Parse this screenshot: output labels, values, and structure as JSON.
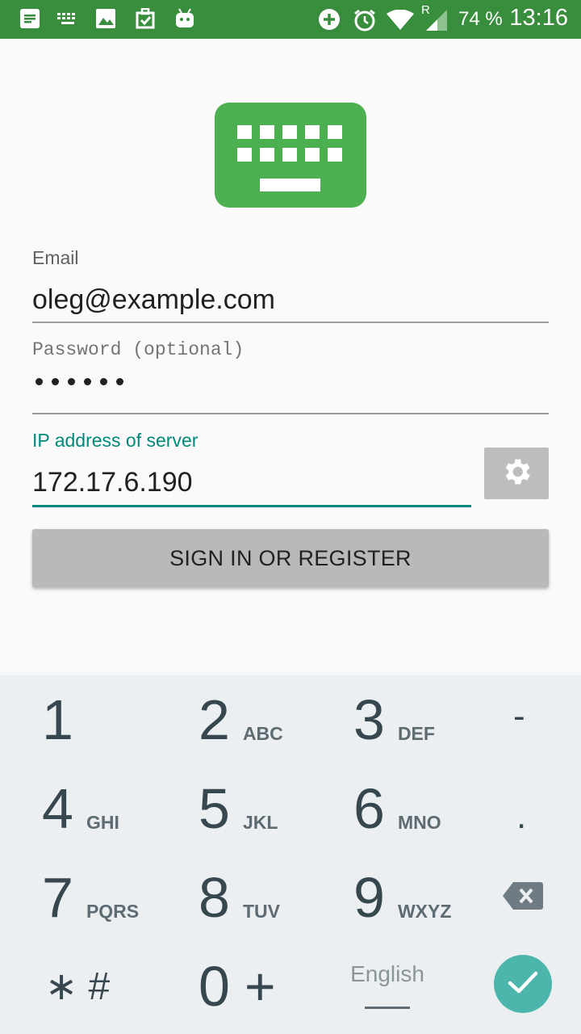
{
  "status_bar": {
    "icons": [
      "notes-icon",
      "keyboard-icon",
      "image-icon",
      "task-icon",
      "android-icon"
    ],
    "right_icons": [
      "data-saver-icon",
      "alarm-icon",
      "wifi-icon",
      "signal-roaming-icon"
    ],
    "roaming_indicator": "R",
    "battery": "74 %",
    "time": "13:16",
    "color": "#388e3c"
  },
  "form": {
    "logo_icon": "keyboard-logo-icon",
    "email_label": "Email",
    "email_value": "oleg@example.com",
    "password_label": "Password (optional)",
    "password_length": 6,
    "ip_label": "IP address of server",
    "ip_value": "172.17.6.190",
    "settings_icon": "gear-icon",
    "signin_label": "SIGN IN OR REGISTER",
    "accent_color": "#00897b",
    "brand_color": "#4caf50"
  },
  "keyboard": {
    "rows": [
      [
        {
          "digit": "1",
          "letters": ""
        },
        {
          "digit": "2",
          "letters": "ABC"
        },
        {
          "digit": "3",
          "letters": "DEF"
        },
        {
          "sym": "-"
        }
      ],
      [
        {
          "digit": "4",
          "letters": "GHI"
        },
        {
          "digit": "5",
          "letters": "JKL"
        },
        {
          "digit": "6",
          "letters": "MNO"
        },
        {
          "sym": "."
        }
      ],
      [
        {
          "digit": "7",
          "letters": "PQRS"
        },
        {
          "digit": "8",
          "letters": "TUV"
        },
        {
          "digit": "9",
          "letters": "WXYZ"
        },
        {
          "icon": "backspace-icon"
        }
      ]
    ],
    "star_hash": "∗ #",
    "zero": "0",
    "plus": "+",
    "language": "English",
    "done_icon": "check-icon",
    "done_color": "#4db6ac"
  }
}
